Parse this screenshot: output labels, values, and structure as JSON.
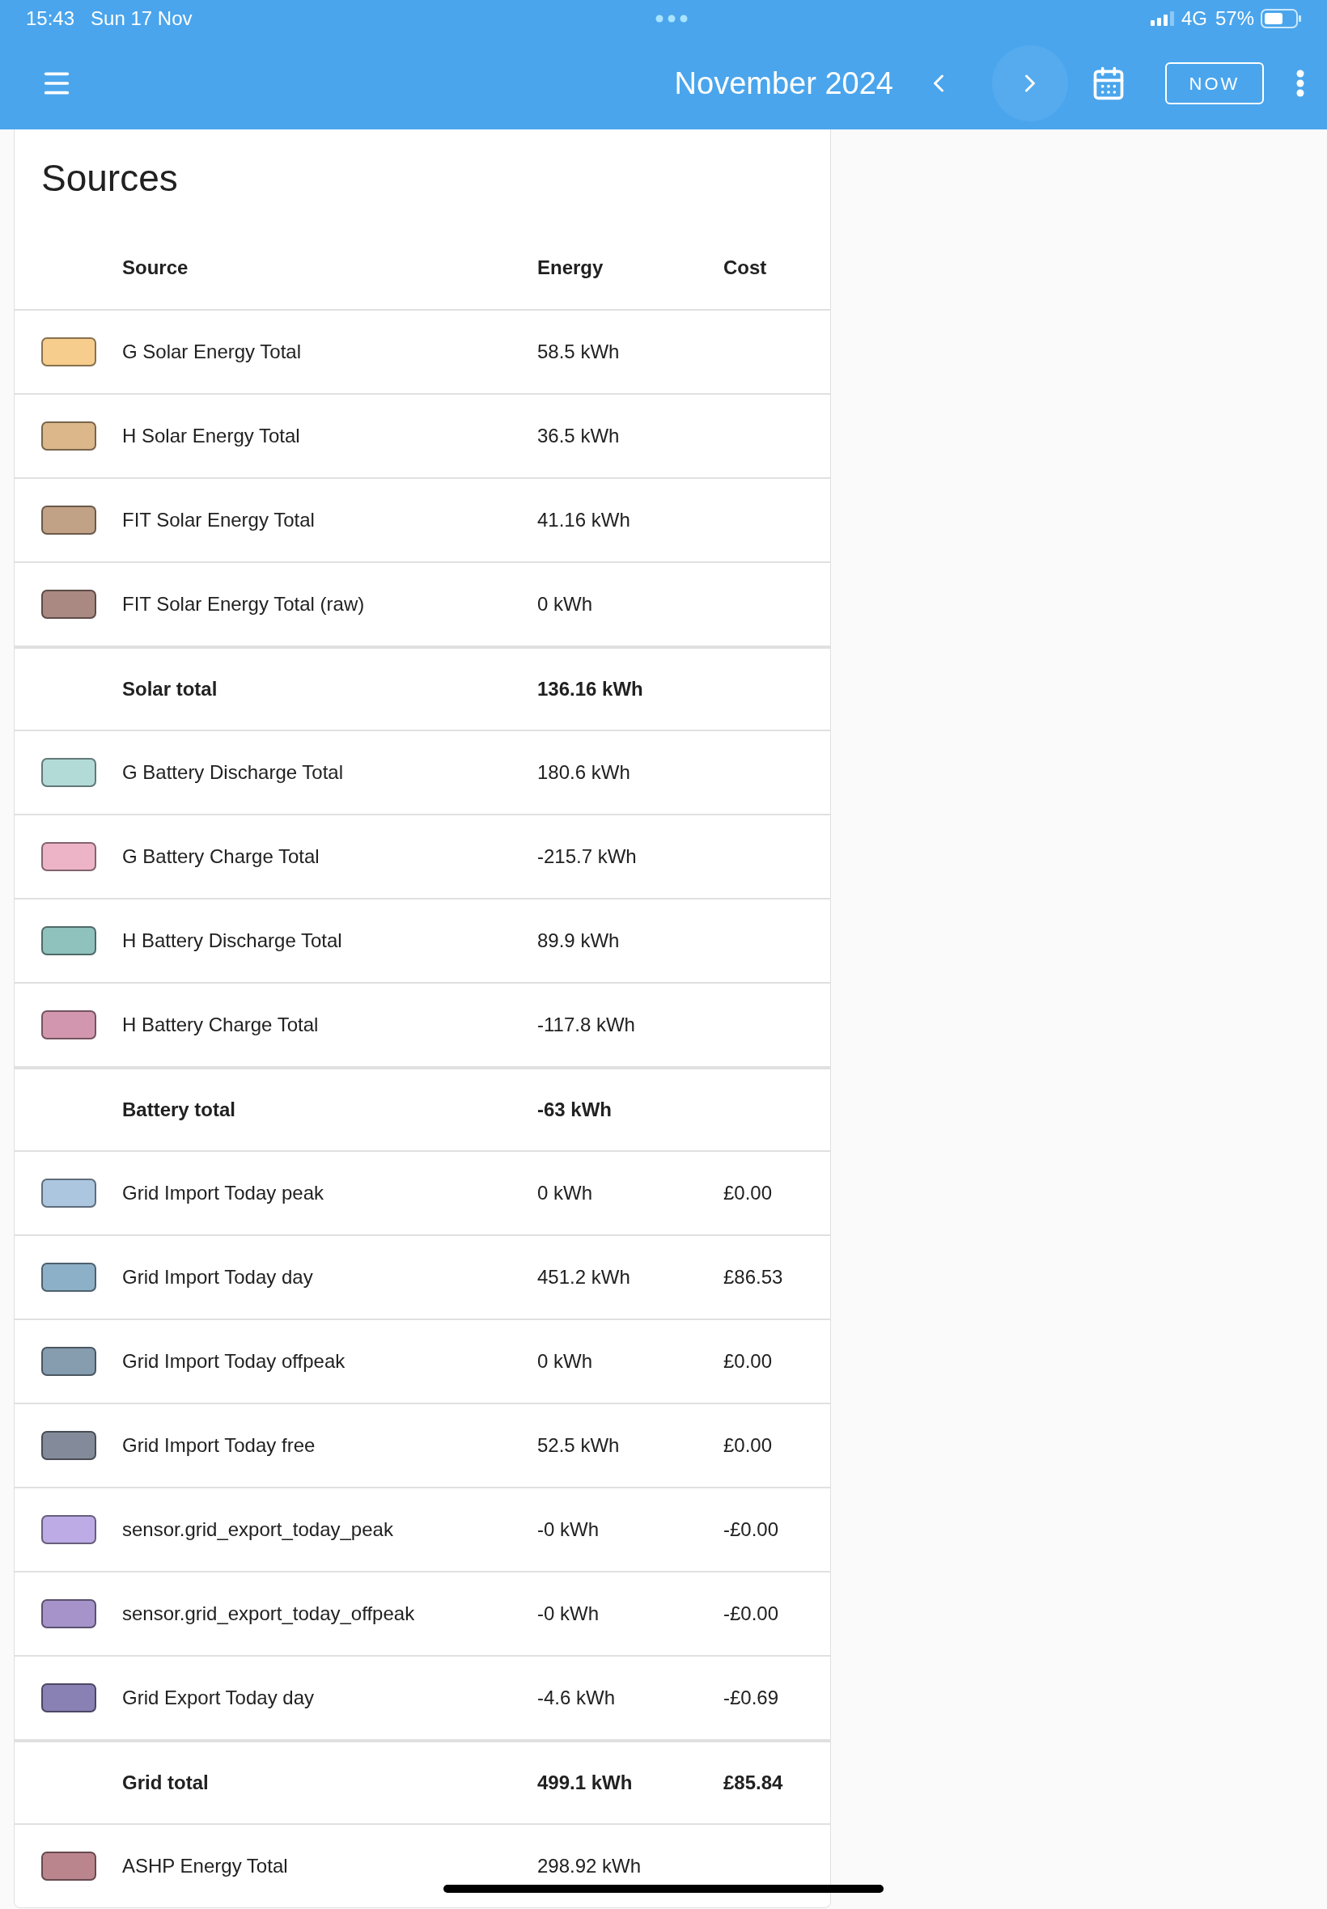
{
  "status_bar": {
    "time": "15:43",
    "date": "Sun 17 Nov",
    "network": "4G",
    "battery": "57%"
  },
  "toolbar": {
    "title": "November 2024",
    "now_button": "NOW"
  },
  "card": {
    "title": "Sources",
    "columns": [
      "Source",
      "Energy",
      "Cost"
    ],
    "rows": [
      {
        "kind": "source",
        "color": "#f6cd8d",
        "name": "G Solar Energy Total",
        "energy": "58.5 kWh"
      },
      {
        "kind": "source",
        "color": "#dbb78a",
        "name": "H Solar Energy Total",
        "energy": "36.5 kWh"
      },
      {
        "kind": "source",
        "color": "#c1a286",
        "name": "FIT Solar Energy Total",
        "energy": "41.16 kWh"
      },
      {
        "kind": "source",
        "color": "#a98982",
        "name": "FIT Solar Energy Total (raw)",
        "energy": "0 kWh"
      },
      {
        "kind": "total",
        "name": "Solar total",
        "energy": "136.16 kWh"
      },
      {
        "kind": "source",
        "color": "#b2dbd8",
        "name": "G Battery Discharge Total",
        "energy": "180.6 kWh"
      },
      {
        "kind": "source",
        "color": "#edb4c8",
        "name": "G Battery Charge Total",
        "energy": "-215.7 kWh"
      },
      {
        "kind": "source",
        "color": "#8fc1bd",
        "name": "H Battery Discharge Total",
        "energy": "89.9 kWh"
      },
      {
        "kind": "source",
        "color": "#d297ae",
        "name": "H Battery Charge Total",
        "energy": "-117.8 kWh"
      },
      {
        "kind": "total",
        "name": "Battery total",
        "energy": "-63 kWh"
      },
      {
        "kind": "source",
        "color": "#acc6e0",
        "name": "Grid Import Today peak",
        "energy": "0 kWh",
        "cost": "£0.00"
      },
      {
        "kind": "source",
        "color": "#8cb0c7",
        "name": "Grid Import Today day",
        "energy": "451.2 kWh",
        "cost": "£86.53"
      },
      {
        "kind": "source",
        "color": "#869caf",
        "name": "Grid Import Today offpeak",
        "energy": "0 kWh",
        "cost": "£0.00"
      },
      {
        "kind": "source",
        "color": "#838a99",
        "name": "Grid Import Today free",
        "energy": "52.5 kWh",
        "cost": "£0.00"
      },
      {
        "kind": "source",
        "color": "#bcabe4",
        "name": "sensor.grid_export_today_peak",
        "energy": "-0 kWh",
        "cost": "-£0.00"
      },
      {
        "kind": "source",
        "color": "#a593ca",
        "name": "sensor.grid_export_today_offpeak",
        "energy": "-0 kWh",
        "cost": "-£0.00"
      },
      {
        "kind": "source",
        "color": "#8981b4",
        "name": "Grid Export Today day",
        "energy": "-4.6 kWh",
        "cost": "-£0.69"
      },
      {
        "kind": "total",
        "name": "Grid total",
        "energy": "499.1 kWh",
        "cost": "£85.84"
      },
      {
        "kind": "source",
        "color": "#bb858d",
        "name": "ASHP Energy Total",
        "energy": "298.92 kWh"
      }
    ]
  }
}
